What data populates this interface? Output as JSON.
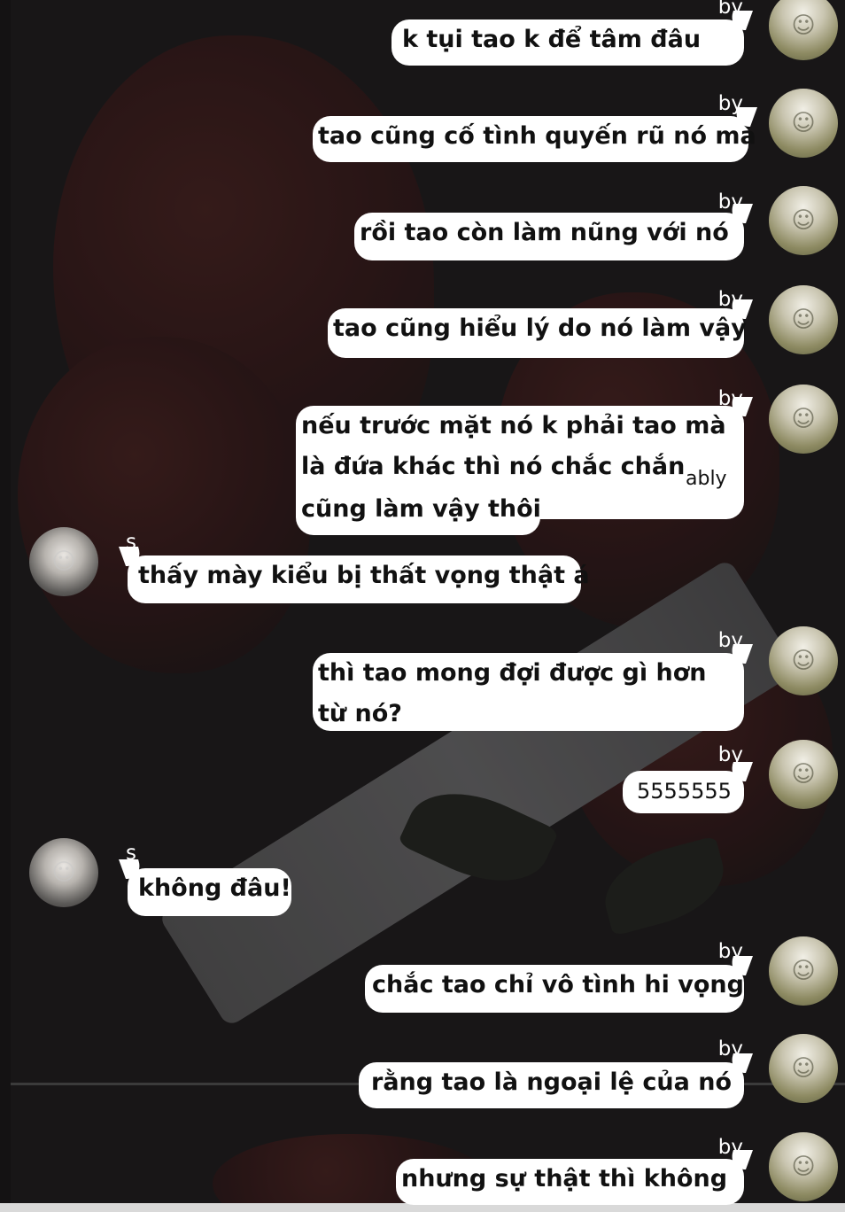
{
  "colors": {
    "bubble": "#ffffff",
    "text": "#111111",
    "name": "#ffffff",
    "background": "#1e1b1c"
  },
  "messages": [
    {
      "sender": "by",
      "side": "right",
      "lines": [
        "k tụi tao k để tâm đâu"
      ]
    },
    {
      "sender": "by",
      "side": "right",
      "lines": [
        "tao cũng cố tình quyến rũ nó mà"
      ]
    },
    {
      "sender": "by",
      "side": "right",
      "lines": [
        "rồi tao còn làm nũng với nó"
      ]
    },
    {
      "sender": "by",
      "side": "right",
      "lines": [
        "tao cũng hiểu lý do nó làm vậy"
      ]
    },
    {
      "sender": "by",
      "side": "right",
      "lines": [
        "nếu trước mặt nó k phải tao mà",
        "là đứa khác thì nó chắc chắn",
        "cũng làm vậy thôi"
      ],
      "overflow": "ably"
    },
    {
      "sender": "s",
      "side": "left",
      "lines": [
        "thấy mày kiểu bị thất vọng thật á"
      ]
    },
    {
      "sender": "by",
      "side": "right",
      "lines": [
        "thì tao mong đợi được gì hơn",
        "từ nó?"
      ]
    },
    {
      "sender": "by",
      "side": "right",
      "lines": [
        "5555555"
      ]
    },
    {
      "sender": "s",
      "side": "left",
      "lines": [
        "không đâu!"
      ]
    },
    {
      "sender": "by",
      "side": "right",
      "lines": [
        "chắc tao chỉ vô tình hi vọng"
      ]
    },
    {
      "sender": "by",
      "side": "right",
      "lines": [
        "rằng tao là ngoại lệ của nó"
      ]
    },
    {
      "sender": "by",
      "side": "right",
      "lines": [
        "nhưng sự thật thì không"
      ]
    }
  ]
}
